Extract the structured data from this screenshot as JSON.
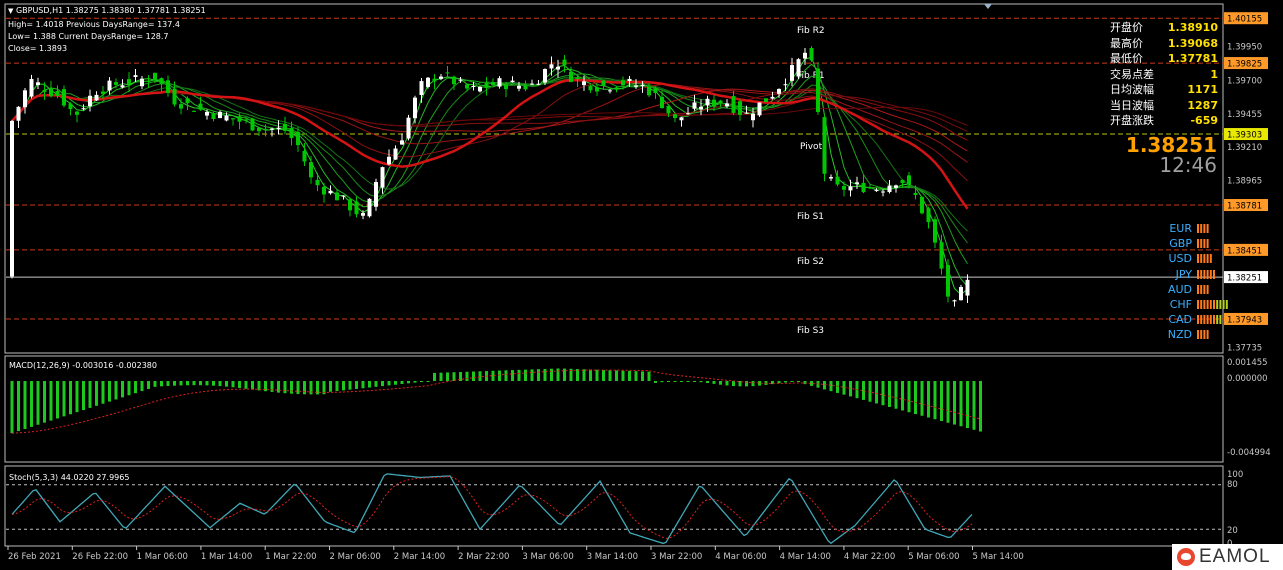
{
  "main_chart": {
    "header": {
      "symbol_line": "GBPUSD,H1  1.38275 1.38380 1.37781 1.38251",
      "stat_lines": [
        "High= 1.4018 Previous DaysRange= 137.4",
        "Low= 1.388 Current DaysRange= 128.7",
        "Close= 1.3893"
      ]
    },
    "price_labels": [
      "1.40155",
      "1.39950",
      "1.39825",
      "1.39700",
      "1.39455",
      "1.39303",
      "1.39210",
      "1.38965",
      "1.38781",
      "1.38451",
      "1.38251",
      "1.37943",
      "1.37735"
    ],
    "level_lines": [
      {
        "name": "Fib R2",
        "price": 1.40155,
        "color": "#c83c14"
      },
      {
        "name": "Fib R1",
        "price": 1.39825,
        "color": "#c83c14"
      },
      {
        "name": "Pivot",
        "price": 1.39303,
        "color": "#b8c81c"
      },
      {
        "name": "Fib S1",
        "price": 1.38781,
        "color": "#c83c14"
      },
      {
        "name": "Fib S2",
        "price": 1.38451,
        "color": "#c83c14"
      },
      {
        "name": "Fib S3",
        "price": 1.37943,
        "color": "#c83c14"
      }
    ],
    "level_labels": [
      "Fib R2",
      "Fib R1",
      "Pivot",
      "Fib S1",
      "Fib S2",
      "Fib S3"
    ],
    "current_price": 1.38251
  },
  "info_panel": {
    "rows": [
      {
        "label": "开盘价",
        "value": "1.38910"
      },
      {
        "label": "最高价",
        "value": "1.39068"
      },
      {
        "label": "最低价",
        "value": "1.37781"
      },
      {
        "label": "交易点差",
        "value": "1"
      },
      {
        "label": "日均波幅",
        "value": "1171"
      },
      {
        "label": "当日波幅",
        "value": "1287"
      },
      {
        "label": "开盘涨跌",
        "value": "-659"
      }
    ],
    "big_price": "1.38251",
    "big_time": "12:46"
  },
  "currency_strength": [
    {
      "name": "EUR",
      "orange": 4,
      "green": 0
    },
    {
      "name": "GBP",
      "orange": 4,
      "green": 0
    },
    {
      "name": "USD",
      "orange": 5,
      "green": 0
    },
    {
      "name": "JPY",
      "orange": 6,
      "green": 0
    },
    {
      "name": "AUD",
      "orange": 4,
      "green": 0
    },
    {
      "name": "CHF",
      "orange": 6,
      "green": 4
    },
    {
      "name": "CAD",
      "orange": 6,
      "green": 2
    },
    {
      "name": "NZD",
      "orange": 4,
      "green": 0
    }
  ],
  "macd": {
    "label": "MACD(12,26,9) -0.003016 -0.002380",
    "scale_labels": [
      "0.001455",
      "0.000000",
      "-0.004994"
    ]
  },
  "stoch": {
    "label": "Stoch(5,3,3) 44.0220 27.9965",
    "scale_labels": [
      "100",
      "80",
      "20",
      "0"
    ]
  },
  "time_axis": [
    "26 Feb 2021",
    "26 Feb 22:00",
    "1 Mar 06:00",
    "1 Mar 14:00",
    "1 Mar 22:00",
    "2 Mar 06:00",
    "2 Mar 14:00",
    "2 Mar 22:00",
    "3 Mar 06:00",
    "3 Mar 14:00",
    "3 Mar 22:00",
    "4 Mar 06:00",
    "4 Mar 14:00",
    "4 Mar 22:00",
    "5 Mar 06:00",
    "5 Mar 14:00"
  ],
  "logo": {
    "text": "EAMOL"
  },
  "colors": {
    "bull": "#ffffff",
    "bear": "#00c800",
    "accent": "#ffa200",
    "label": "#ffe000",
    "axis": "#c8c8c8"
  }
}
